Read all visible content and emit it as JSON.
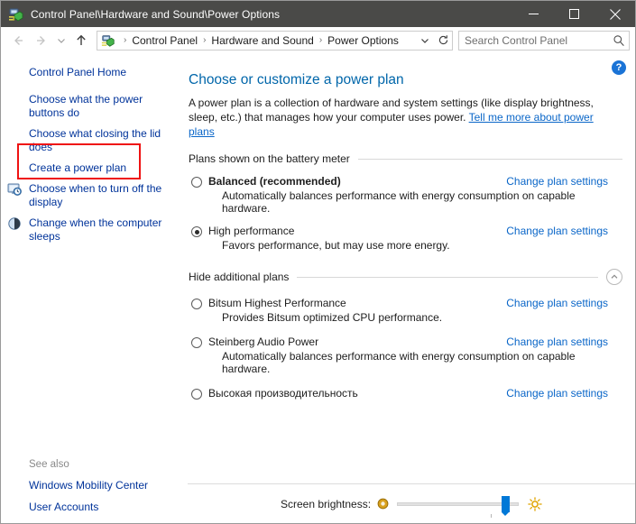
{
  "window": {
    "title": "Control Panel\\Hardware and Sound\\Power Options",
    "icon": "power-options-icon",
    "minimize_label": "Minimize",
    "maximize_label": "Maximize",
    "close_label": "Close"
  },
  "navbar": {
    "back_label": "Back",
    "forward_label": "Forward",
    "recent_label": "Recent locations",
    "up_label": "Up one level",
    "breadcrumb": [
      "Control Panel",
      "Hardware and Sound",
      "Power Options"
    ],
    "breadcrumb_separator": "›",
    "dropdown_label": "Previous locations",
    "refresh_label": "Refresh",
    "search": {
      "placeholder": "Search Control Panel",
      "value": ""
    }
  },
  "sidebar": {
    "home_label": "Control Panel Home",
    "items": [
      {
        "label": "Choose what the power buttons do",
        "icon": null,
        "highlighted": true
      },
      {
        "label": "Choose what closing the lid does",
        "icon": null,
        "highlighted": false
      },
      {
        "label": "Create a power plan",
        "icon": null,
        "highlighted": false
      },
      {
        "label": "Choose when to turn off the display",
        "icon": "display-clock-icon",
        "highlighted": false
      },
      {
        "label": "Change when the computer sleeps",
        "icon": "moon-sleep-icon",
        "highlighted": false
      }
    ],
    "see_also": {
      "label": "See also",
      "links": [
        "Windows Mobility Center",
        "User Accounts"
      ]
    }
  },
  "main": {
    "help_label": "?",
    "title": "Choose or customize a power plan",
    "intro_text": "A power plan is a collection of hardware and system settings (like display brightness, sleep, etc.) that manages how your computer uses power. ",
    "intro_link": "Tell me more about power plans",
    "section_primary": {
      "label": "Plans shown on the battery meter",
      "plans": [
        {
          "name": "Balanced (recommended)",
          "bold": true,
          "selected": false,
          "description": "Automatically balances performance with energy consumption on capable hardware.",
          "link": "Change plan settings"
        },
        {
          "name": "High performance",
          "bold": false,
          "selected": true,
          "description": "Favors performance, but may use more energy.",
          "link": "Change plan settings"
        }
      ]
    },
    "section_additional": {
      "label": "Hide additional plans",
      "collapse_icon": "chevron-up-icon",
      "plans": [
        {
          "name": "Bitsum Highest Performance",
          "bold": false,
          "selected": false,
          "description": "Provides Bitsum optimized CPU performance.",
          "link": "Change plan settings"
        },
        {
          "name": "Steinberg Audio Power",
          "bold": false,
          "selected": false,
          "description": "Automatically balances performance with energy consumption on capable hardware.",
          "link": "Change plan settings"
        },
        {
          "name": "Высокая производительность",
          "bold": false,
          "selected": false,
          "description": "",
          "link": "Change plan settings"
        }
      ]
    }
  },
  "brightness": {
    "label": "Screen brightness:",
    "low_icon": "brightness-low-icon",
    "high_icon": "brightness-high-icon",
    "value_percent": 89
  },
  "colors": {
    "titlebar_bg": "#4a4a48",
    "link": "#0a66c8",
    "sidebar_link": "#00339a",
    "heading": "#0066aa",
    "accent": "#0078d7",
    "highlight_border": "#ef1212",
    "help_badge": "#1a73d6"
  }
}
